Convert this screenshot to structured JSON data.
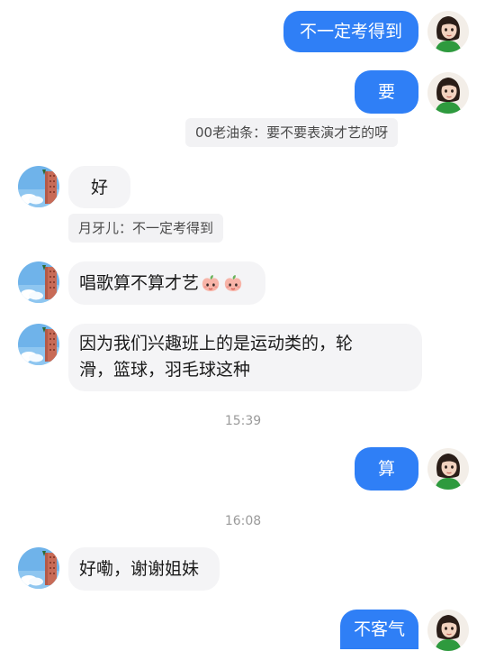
{
  "messages": {
    "m1": "不一定考得到",
    "m2": "要",
    "q1": "00老油条：要不要表演才艺的呀",
    "m3": "好",
    "q2": "月牙儿：不一定考得到",
    "m4": "唱歌算不算才艺",
    "m5": "因为我们兴趣班上的是运动类的，轮滑，篮球，羽毛球这种",
    "t1": "15:39",
    "m6": "算",
    "t2": "16:08",
    "m7": "好嘞，谢谢姐妹",
    "m8": "不客气"
  },
  "colors": {
    "outgoing_bubble": "#2f7ff6",
    "incoming_bubble": "#f4f4f6",
    "timestamp": "#9a9a9a"
  },
  "icons": {
    "peach": "peach-emoji",
    "self_avatar": "girl-avatar",
    "other_avatar": "sky-building-avatar"
  }
}
